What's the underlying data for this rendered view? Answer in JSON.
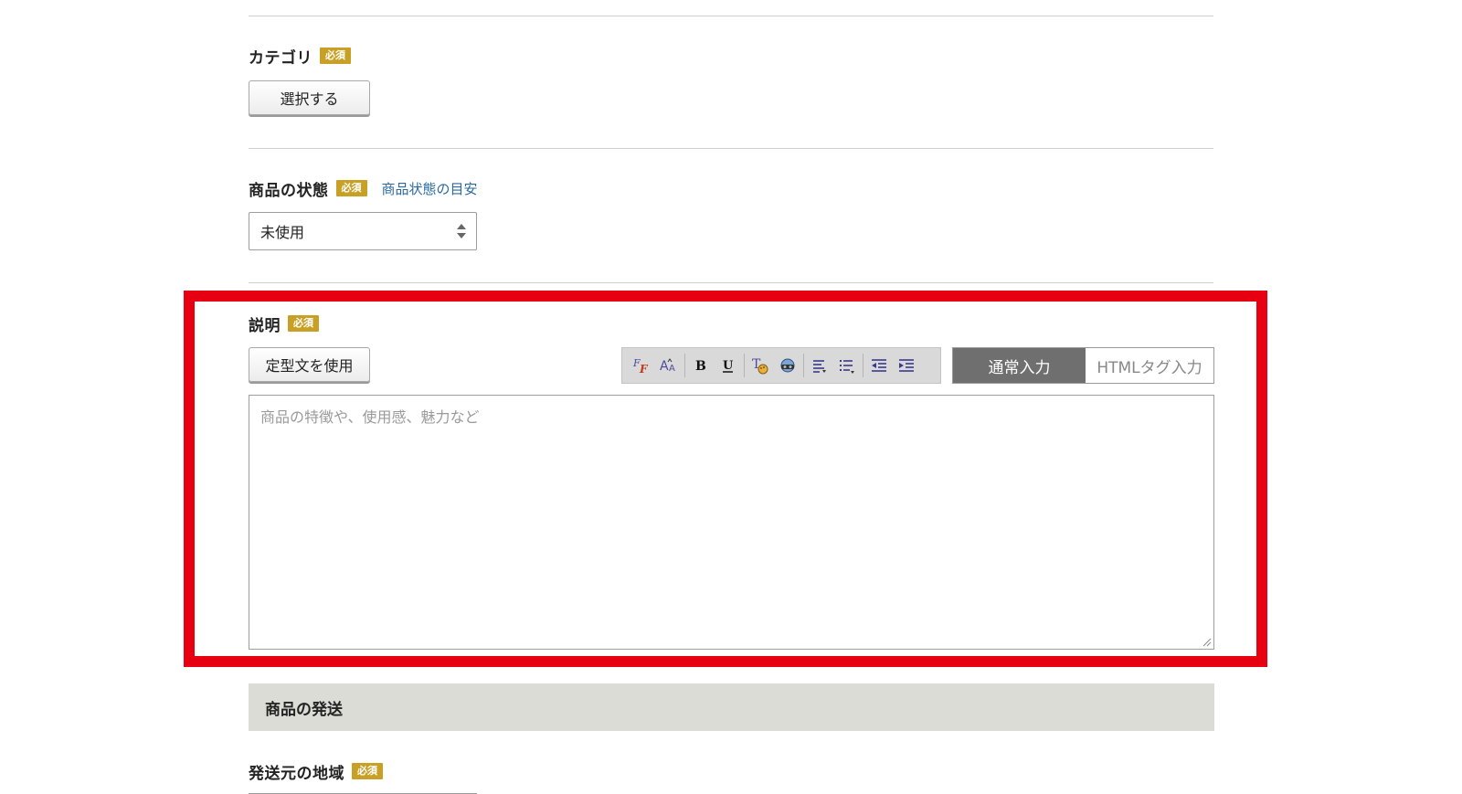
{
  "category": {
    "label": "カテゴリ",
    "required_badge": "必須",
    "select_button": "選択する"
  },
  "condition": {
    "label": "商品の状態",
    "required_badge": "必須",
    "guide_link": "商品状態の目安",
    "selected_value": "未使用"
  },
  "description": {
    "label": "説明",
    "required_badge": "必須",
    "template_button": "定型文を使用",
    "toolbar_icons": [
      "font-family-icon",
      "font-size-icon",
      "bold-icon",
      "underline-icon",
      "text-color-icon",
      "link-icon",
      "align-icon",
      "list-icon",
      "outdent-icon",
      "indent-icon"
    ],
    "mode_normal": "通常入力",
    "mode_html": "HTMLタグ入力",
    "placeholder": "商品の特徴や、使用感、魅力など"
  },
  "shipping": {
    "section_title": "商品の発送",
    "origin_label": "発送元の地域",
    "required_badge": "必須"
  },
  "colors": {
    "badge": "#c8a026",
    "highlight_frame": "#e60012",
    "link": "#2a6aa0",
    "active_mode": "#6f6f6f"
  }
}
